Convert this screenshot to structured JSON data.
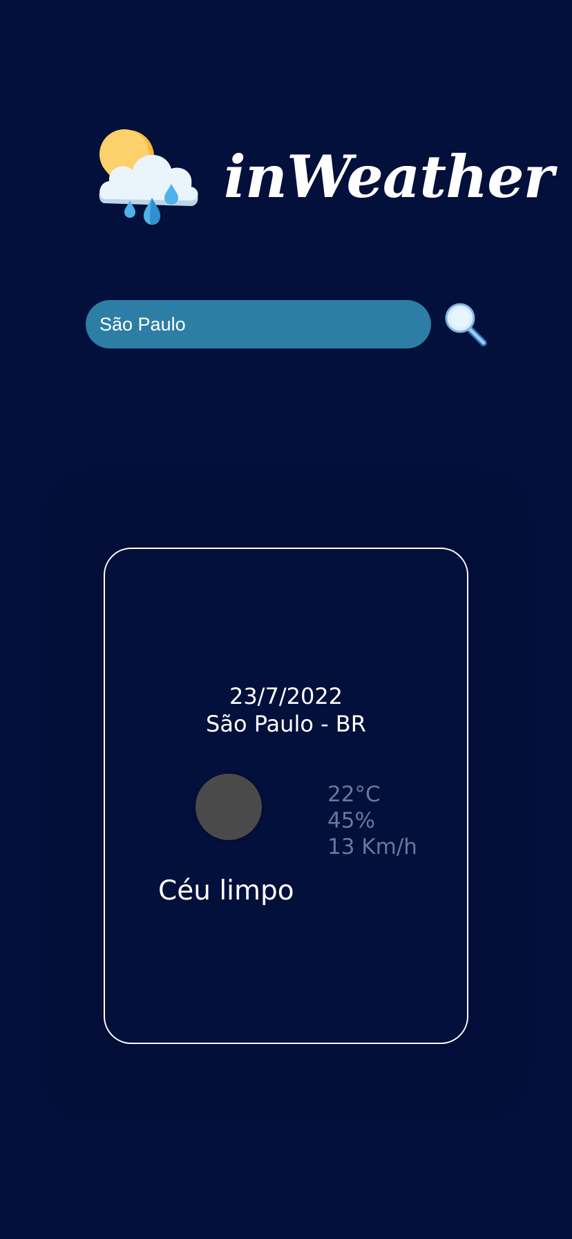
{
  "app": {
    "title": "inWeather",
    "logo_icon": "cloud-sun-rain-icon"
  },
  "search": {
    "value": "São Paulo",
    "button_icon": "magnifier-icon"
  },
  "weather": {
    "date": "23/7/2022",
    "location": "São Paulo - BR",
    "temperature": "22°C",
    "humidity": "45%",
    "wind": "13 Km/h",
    "description": "Céu limpo",
    "condition_icon": "weather-condition-icon"
  },
  "colors": {
    "background": "#03103b",
    "search_bar": "#2d7ea4",
    "card_border": "#ffffff",
    "stats_text": "#6b779a"
  }
}
